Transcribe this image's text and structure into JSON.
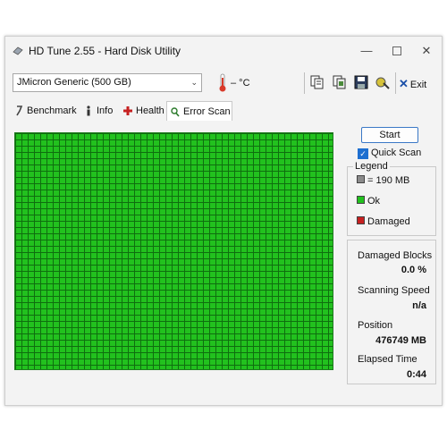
{
  "window": {
    "title": "HD Tune 2.55 - Hard Disk Utility"
  },
  "toolbar": {
    "drive": "JMicron Generic (500 GB)",
    "temperature": "– °C",
    "exit_label": "Exit",
    "exit_glyph": "✕"
  },
  "tabs": [
    {
      "label": "Benchmark"
    },
    {
      "label": "Info"
    },
    {
      "label": "Health"
    },
    {
      "label": "Error Scan"
    }
  ],
  "scan": {
    "start_label": "Start",
    "quick_scan_label": "Quick Scan",
    "quick_scan_checked": true,
    "checkmark": "✓"
  },
  "legend": {
    "title": "Legend",
    "block_size": "= 190 MB",
    "ok": "Ok",
    "damaged": "Damaged"
  },
  "stats": {
    "damaged_blocks_label": "Damaged Blocks",
    "damaged_blocks_value": "0.0 %",
    "scanning_speed_label": "Scanning Speed",
    "scanning_speed_value": "n/a",
    "position_label": "Position",
    "position_value": "476749 MB",
    "elapsed_label": "Elapsed Time",
    "elapsed_value": "0:44"
  },
  "colors": {
    "block_ok": "#22c11e",
    "block_damaged": "#c62020",
    "block_grey": "#8a8a8a",
    "accent": "#3a78c6"
  },
  "icons": {
    "app": "disk-icon",
    "thermometer": "thermometer-icon",
    "toolbar": [
      "copy-text-icon",
      "copy-image-icon",
      "save-icon",
      "options-icon"
    ]
  }
}
